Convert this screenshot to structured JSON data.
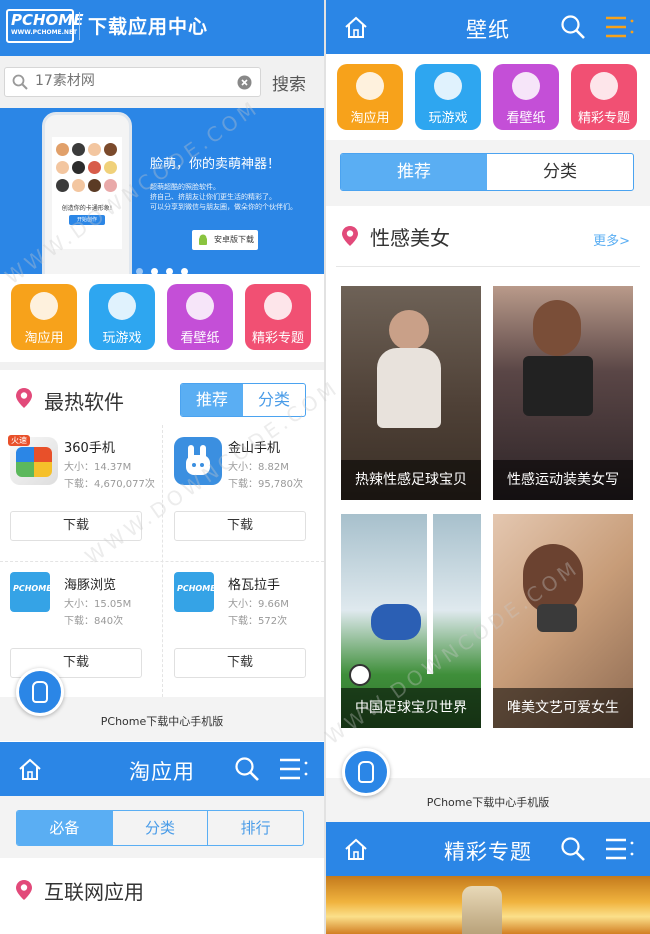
{
  "left": {
    "logo_text": "PCHOME",
    "logo_sub": "WWW.PCHOME.NET",
    "header_title": "下载应用中心",
    "search_placeholder": "17素材网",
    "search_button": "搜索",
    "banner": {
      "headline": "脸萌，你的卖萌神器！",
      "bullets": [
        "超萌超酷的照脸软件。",
        "挤自己、挤朋友让你们更生活的精彩了。",
        "可以分享到微信与朋友圈，做朵你的个伙伴们。"
      ],
      "phone_caption": "创造你的卡通形象!",
      "phone_button": "开始创作",
      "download_label": "安卓版下载"
    },
    "categories": [
      {
        "label": "淘应用",
        "color": "#f7a21b",
        "icon": "gear-icon"
      },
      {
        "label": "玩游戏",
        "color": "#2ea6f0",
        "icon": "gamepad-icon"
      },
      {
        "label": "看壁纸",
        "color": "#c44fd7",
        "icon": "picture-icon"
      },
      {
        "label": "精彩专题",
        "color": "#f15073",
        "icon": "heart-icon"
      }
    ],
    "hot_title": "最热软件",
    "hot_tabs": [
      "推荐",
      "分类"
    ],
    "apps": [
      {
        "name": "360手机",
        "size": "大小：14.37M",
        "downloads": "下载：4,670,077次",
        "button": "下载",
        "icon_color": "#e8502a",
        "icon_badge": "火速"
      },
      {
        "name": "金山手机",
        "size": "大小：8.82M",
        "downloads": "下载：95,780次",
        "button": "下载",
        "icon_color": "#3b8fe0",
        "icon_badge": ""
      },
      {
        "name": "海豚浏览",
        "size": "大小：15.05M",
        "downloads": "下载：840次",
        "button": "下载",
        "icon_color": "#35a3e6",
        "icon_badge": "PCHOME"
      },
      {
        "name": "格瓦拉手",
        "size": "大小：9.66M",
        "downloads": "下载：572次",
        "button": "下载",
        "icon_color": "#35a3e6",
        "icon_badge": "PCHOME"
      }
    ],
    "footer": "PChome下载中心手机版",
    "second_bar_title": "淘应用",
    "app_tabs": [
      "必备",
      "分类",
      "排行"
    ],
    "section2_title": "互联网应用"
  },
  "right": {
    "header_title": "壁纸",
    "categories": [
      {
        "label": "淘应用",
        "color": "#f7a21b",
        "icon": "gear-icon"
      },
      {
        "label": "玩游戏",
        "color": "#2ea6f0",
        "icon": "gamepad-icon"
      },
      {
        "label": "看壁纸",
        "color": "#c44fd7",
        "icon": "picture-icon"
      },
      {
        "label": "精彩专题",
        "color": "#f15073",
        "icon": "heart-icon"
      }
    ],
    "tabs": [
      "推荐",
      "分类"
    ],
    "section_title": "性感美女",
    "more_link": "更多>",
    "photos": [
      {
        "caption": "热辣性感足球宝贝",
        "tone": "#5a4a3e"
      },
      {
        "caption": "性感运动装美女写",
        "tone": "#3c3032"
      },
      {
        "caption": "中国足球宝贝世界",
        "tone": "#6b8f9c"
      },
      {
        "caption": "唯美文艺可爱女生",
        "tone": "#b08a68"
      }
    ],
    "footer": "PChome下载中心手机版",
    "second_bar_title": "精彩专题"
  },
  "watermark": "WWW.DOWNCODE.COM",
  "colors": {
    "brand_blue": "#2b86e6",
    "tab_blue": "#5aaef3",
    "pin_pink": "#e24a7a"
  }
}
